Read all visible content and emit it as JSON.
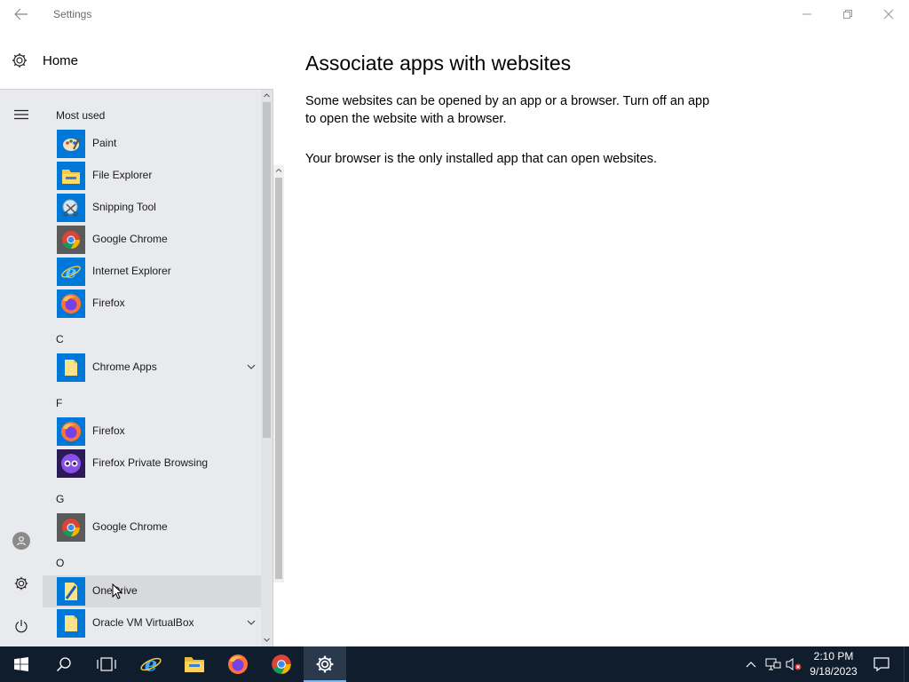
{
  "window": {
    "title": "Settings",
    "home_label": "Home"
  },
  "content": {
    "title": "Associate apps with websites",
    "description": "Some websites can be opened by an app or a browser.  Turn off an app to open the website with a browser.",
    "status": "Your browser is the only installed app that can open websites."
  },
  "start_menu": {
    "most_used_header": "Most used",
    "most_used": [
      {
        "label": "Paint",
        "icon": "paint-icon"
      },
      {
        "label": "File Explorer",
        "icon": "file-explorer-icon"
      },
      {
        "label": "Snipping Tool",
        "icon": "snipping-tool-icon"
      },
      {
        "label": "Google Chrome",
        "icon": "chrome-icon"
      },
      {
        "label": "Internet Explorer",
        "icon": "internet-explorer-icon"
      },
      {
        "label": "Firefox",
        "icon": "firefox-icon"
      }
    ],
    "sections": [
      {
        "letter": "C",
        "items": [
          {
            "label": "Chrome Apps",
            "icon": "folder-icon",
            "expandable": true
          }
        ]
      },
      {
        "letter": "F",
        "items": [
          {
            "label": "Firefox",
            "icon": "firefox-icon"
          },
          {
            "label": "Firefox Private Browsing",
            "icon": "firefox-private-icon"
          }
        ]
      },
      {
        "letter": "G",
        "items": [
          {
            "label": "Google Chrome",
            "icon": "chrome-icon"
          }
        ]
      },
      {
        "letter": "O",
        "items": [
          {
            "label": "OneDrive",
            "icon": "onedrive-icon"
          },
          {
            "label": "Oracle VM VirtualBox",
            "icon": "folder-icon",
            "expandable": true
          }
        ]
      }
    ]
  },
  "taskbar": {
    "pinned": [
      "start-icon",
      "search-icon",
      "task-view-icon",
      "internet-explorer-icon",
      "file-explorer-icon",
      "firefox-icon",
      "chrome-icon",
      "settings-icon"
    ],
    "time": "2:10 PM",
    "date": "9/18/2023"
  },
  "colors": {
    "accent": "#0078d7",
    "taskbar": "#0f1d2d",
    "start_menu": "#e9eaee"
  }
}
